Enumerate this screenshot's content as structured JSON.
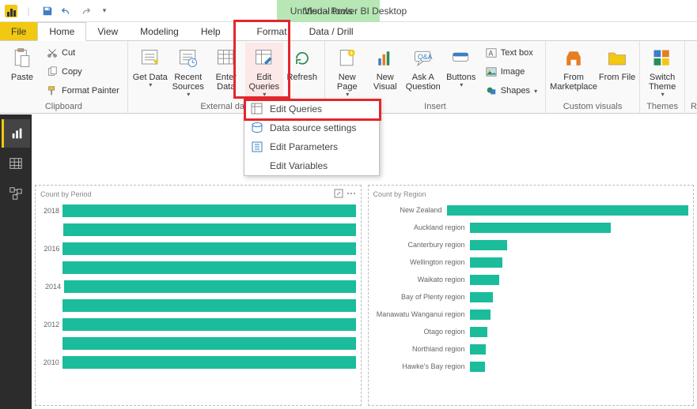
{
  "app": {
    "title": "Untitled - Power BI Desktop",
    "contextual": "Visual tools"
  },
  "tabs": {
    "file": "File",
    "home": "Home",
    "view": "View",
    "modeling": "Modeling",
    "help": "Help",
    "format": "Format",
    "datadrill": "Data / Drill"
  },
  "ribbon": {
    "paste": "Paste",
    "cut": "Cut",
    "copy": "Copy",
    "formatpainter": "Format Painter",
    "clipboard_group": "Clipboard",
    "getdata": "Get Data",
    "recent": "Recent Sources",
    "enterdata": "Enter Data",
    "editqueries": "Edit Queries",
    "refresh": "Refresh",
    "externaldata_group": "External data",
    "newpage": "New Page",
    "newvisual": "New Visual",
    "ask": "Ask A Question",
    "buttons": "Buttons",
    "textbox": "Text box",
    "image": "Image",
    "shapes": "Shapes",
    "insert_group": "Insert",
    "frommarket": "From Marketplace",
    "fromfile": "From File",
    "custom_group": "Custom visuals",
    "switchtheme": "Switch Theme",
    "themes_group": "Themes",
    "re": "Re"
  },
  "dropdown": {
    "editqueries": "Edit Queries",
    "datasource": "Data source settings",
    "editparams": "Edit Parameters",
    "editvars": "Edit Variables"
  },
  "chart_data": [
    {
      "type": "bar",
      "title": "Count by Period",
      "orientation": "horizontal",
      "xlabel": "",
      "ylabel": "",
      "categories": [
        "2018",
        "",
        "2016",
        "",
        "2014",
        "",
        "2012",
        "",
        "2010"
      ],
      "values": [
        355,
        340,
        350,
        355,
        330,
        350,
        353,
        360,
        358
      ],
      "max": 360,
      "color": "#1abc9c"
    },
    {
      "type": "bar",
      "title": "Count by Region",
      "orientation": "horizontal",
      "xlabel": "",
      "ylabel": "",
      "categories": [
        "New Zealand",
        "Auckland region",
        "Canterbury region",
        "Wellington region",
        "Waikato region",
        "Bay of Plenty region",
        "Manawatu Wanganui region",
        "Otago region",
        "Northland region",
        "Hawke's Bay region"
      ],
      "values": [
        270,
        120,
        32,
        28,
        25,
        20,
        18,
        15,
        14,
        13
      ],
      "max": 270,
      "color": "#1abc9c"
    }
  ]
}
